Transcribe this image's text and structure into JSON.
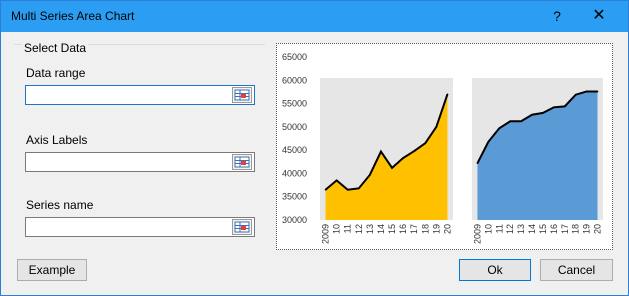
{
  "window": {
    "title": "Multi Series Area Chart",
    "help_label": "?",
    "close_label": "✕"
  },
  "form": {
    "group_label": "Select Data",
    "data_range": {
      "label": "Data range",
      "value": ""
    },
    "axis_labels": {
      "label": "Axis Labels",
      "value": ""
    },
    "series_name": {
      "label": "Series name",
      "value": ""
    }
  },
  "buttons": {
    "example": "Example",
    "ok": "Ok",
    "cancel": "Cancel"
  },
  "colors": {
    "series1": "#ffc000",
    "series2": "#5b9bd5",
    "plot_background": "#e6e6e6",
    "line": "#000000"
  },
  "chart_data": {
    "type": "area",
    "ylim": [
      30000,
      65000
    ],
    "yticks": [
      30000,
      35000,
      40000,
      45000,
      50000,
      55000,
      60000,
      65000
    ],
    "series": [
      {
        "categories": [
          "2009",
          "10",
          "11",
          "12",
          "13",
          "14",
          "15",
          "16",
          "17",
          "18",
          "19",
          "20"
        ],
        "values": [
          36500,
          38500,
          36500,
          36800,
          39700,
          44700,
          41200,
          43300,
          44800,
          46500,
          50000,
          57000
        ]
      },
      {
        "categories": [
          "2009",
          "10",
          "11",
          "12",
          "13",
          "14",
          "15",
          "16",
          "17",
          "18",
          "19",
          "20"
        ],
        "values": [
          42200,
          46800,
          49700,
          51200,
          51200,
          52600,
          53000,
          54200,
          54400,
          56900,
          57600,
          57600
        ]
      }
    ]
  }
}
